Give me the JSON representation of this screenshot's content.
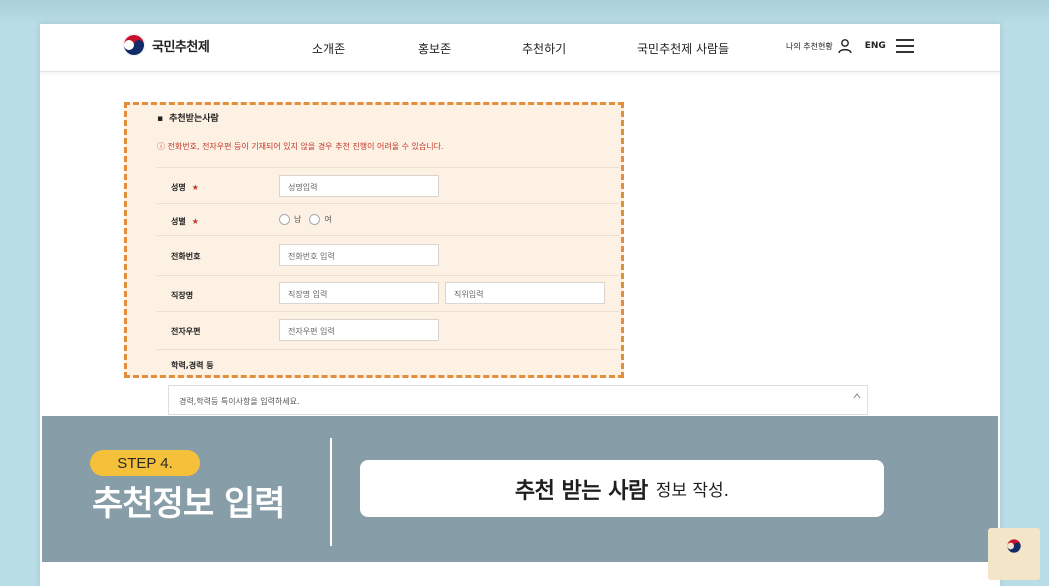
{
  "header": {
    "logo_text": "국민추천제",
    "nav": [
      "소개존",
      "홍보존",
      "추천하기",
      "국민추천제 사람들"
    ],
    "my_status": "나의 추천현황",
    "lang": "ENG"
  },
  "form": {
    "section_title": "추천받는사람",
    "warning": "ⓘ 전화번호, 전자우편 등이 기재되어 있지 않을 경우 추천 진행이 어려울 수 있습니다.",
    "required_mark": "★",
    "fields": {
      "name_label": "성명",
      "name_placeholder": "성명입력",
      "gender_label": "성별",
      "gender_male": "남",
      "gender_female": "여",
      "phone_label": "전화번호",
      "phone_placeholder": "전화번호 입력",
      "workplace_label": "직장명",
      "workplace_placeholder": "직장명 입력",
      "position_placeholder": "직위입력",
      "email_label": "전자우편",
      "email_placeholder": "전자우편 입력",
      "career_label": "학력,경력 등",
      "career_placeholder": "경력,학력등 특이사항을 입력하세요."
    }
  },
  "banner": {
    "step": "STEP 4.",
    "title": "추천정보 입력",
    "caption_strong": "추천 받는 사람",
    "caption_light": "정보 작성."
  },
  "colors": {
    "form_border": "#e38e3a",
    "form_bg": "#fdf1e4",
    "step_badge": "#f5c13a",
    "banner_bg": "#7e96a0",
    "page_bg": "#b9dde6"
  }
}
